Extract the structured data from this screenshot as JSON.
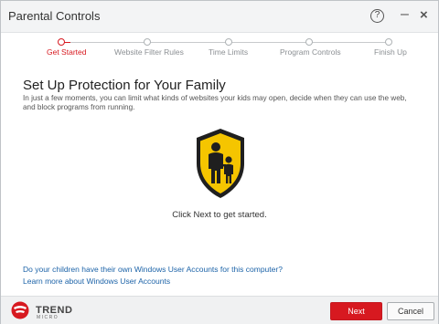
{
  "window": {
    "title": "Parental Controls"
  },
  "titlebar": {
    "help_glyph": "?",
    "minimize_glyph": "–",
    "close_glyph": "×"
  },
  "steps": [
    {
      "label": "Get Started",
      "active": true
    },
    {
      "label": "Website Filter Rules",
      "active": false
    },
    {
      "label": "Time Limits",
      "active": false
    },
    {
      "label": "Program Controls",
      "active": false
    },
    {
      "label": "Finish Up",
      "active": false
    }
  ],
  "main": {
    "heading": "Set Up Protection for Your Family",
    "description": "In just a few moments, you can limit what kinds of websites your kids may open, decide when they can use the web, and block programs from running.",
    "illustration_icon": "family-shield-icon",
    "hint": "Click Next to get started.",
    "links": [
      "Do your children have their own Windows User Accounts for this computer?",
      "Learn more about Windows User Accounts"
    ]
  },
  "footer": {
    "brand_top": "TREND",
    "brand_bottom": "MICRO",
    "next_label": "Next",
    "cancel_label": "Cancel"
  },
  "colors": {
    "accent": "#d71920",
    "shield_yellow": "#f5c500",
    "shield_dark": "#1f1f1f",
    "link": "#1c63a8"
  }
}
